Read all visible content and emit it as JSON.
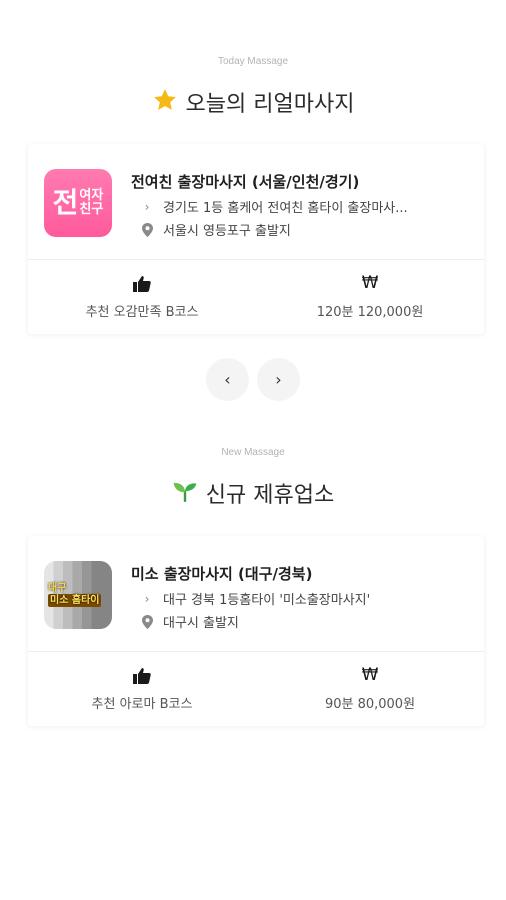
{
  "today": {
    "eyebrow": "Today Massage",
    "title": "오늘의 리얼마사지",
    "title_icon": "star-icon",
    "card": {
      "thumb_big": "전",
      "thumb_small_top": "여자",
      "thumb_small_bottom": "친구",
      "title": "전여친 출장마사지 (서울/인천/경기)",
      "desc": "경기도 1등 홈케어 전여친 홈타이 출장마사...",
      "location": "서울시 영등포구 출발지",
      "recommend": "추천 오감만족 B코스",
      "price": "120분 120,000원"
    }
  },
  "pager": {
    "prev_icon": "chevron-left-icon",
    "next_icon": "chevron-right-icon"
  },
  "new": {
    "eyebrow": "New Massage",
    "title": "신규 제휴업소",
    "title_icon": "sprout-icon",
    "card": {
      "thumb_badge_1": "대구",
      "thumb_badge_2": "미소 홈타이",
      "title": "미소 출장마사지 (대구/경북)",
      "desc": "대구 경북 1등홈타이 '미소출장마사지'",
      "location": "대구시 출발지",
      "recommend": "추천 아로마 B코스",
      "price": "90분 80,000원"
    }
  },
  "colors": {
    "pink": "#ff6aa6",
    "accent_star": "#f5b915",
    "sprout": "#38b04a"
  }
}
